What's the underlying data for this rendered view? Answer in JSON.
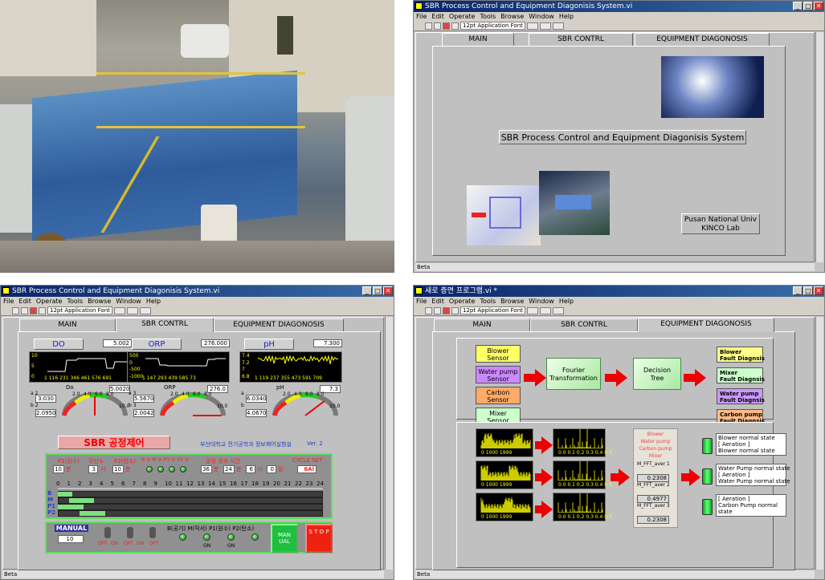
{
  "window_controls": {
    "min": "_",
    "max": "□",
    "close": "✕"
  },
  "menu": [
    "File",
    "Edit",
    "Operate",
    "Tools",
    "Browse",
    "Window",
    "Help"
  ],
  "toolbar": {
    "font": "12pt Application Font"
  },
  "status_bar": "Beta",
  "win1": {
    "title": "SBR Process Control and Equipment Diagonisis System.vi",
    "tabs": [
      "MAIN",
      "SBR CONTRL",
      "EQUIPMENT DIAGONOSIS"
    ],
    "banner": "SBR Process Control and Equipment Diagonisis System",
    "org_line1": "Pusan National Univ",
    "org_line2": "KINCO Lab"
  },
  "win2": {
    "title": "SBR Process Control and Equipment Diagonisis System.vi",
    "tabs": [
      "MAIN",
      "SBR CONTRL",
      "EQUIPMENT DIAGONOSIS"
    ],
    "do": {
      "label": "DO",
      "value": "5.002",
      "axis": [
        "10",
        "5",
        "0"
      ],
      "x": "1  116 231 346 461 576 691",
      "name": "Do",
      "meas": "5.0020",
      "a": "3.030",
      "b": "2.0950",
      "ga": "a 2",
      "gb": "b 2",
      "scale": [
        "2.0",
        "4.0",
        "6.0",
        "8.0"
      ],
      "end": "10.0"
    },
    "orp": {
      "label": "ORP",
      "value": "276.000",
      "axis": [
        "500",
        "0",
        "-500",
        "-1000"
      ],
      "x": "1  147 293 439 585 73",
      "name": "ORP",
      "meas": "276.0",
      "a": "5.5670",
      "b": "2.0042",
      "ga": "a 3",
      "gb": "b 3",
      "scale": [
        "2.0",
        "4.0",
        "6.0",
        "8.0"
      ],
      "end": "10.0"
    },
    "ph": {
      "label": "pH",
      "value": "7.300",
      "axis": [
        "7.4",
        "7.2",
        "7",
        "6.8"
      ],
      "x": "1  119 237 355 473 591 709",
      "name": "pH",
      "meas": "7.3",
      "a": "6.0340",
      "b": "4.0670",
      "ga": "a",
      "gb": "b",
      "scale": [
        "2.0",
        "4.0",
        "6.0",
        "8.0"
      ],
      "end": "10.0"
    },
    "process_title": "SBR 공정제어",
    "dept": "부산대학교 전기공학과 정보제어실험실",
    "ver": "Ver. 2",
    "cycle": {
      "p1_label": "P1(원수)",
      "p1": "10",
      "p1_unit": "분",
      "mix_label": "무산소",
      "mix": "3",
      "mix_unit": "시",
      "p2_label": "P2(탄소)",
      "p2": "10",
      "p2_unit": "분",
      "on_label": "B ② M ② P1 ② P2 ②",
      "time_label": "공정 경과 시간",
      "t1": "36",
      "t1u": "분",
      "t2": "24",
      "t2u": "분",
      "t3": "6",
      "t3u": "시",
      "t4": "0",
      "t4u": "일",
      "cycle_label": "CYCLE SET",
      "cycle": "6Al"
    },
    "hours": [
      "0",
      "1",
      "2",
      "3",
      "4",
      "5",
      "6",
      "7",
      "8",
      "9",
      "10",
      "11",
      "12",
      "13",
      "14",
      "15",
      "16",
      "17",
      "18",
      "19",
      "20",
      "21",
      "22",
      "23",
      "24"
    ],
    "rows": [
      "B",
      "M",
      "P1",
      "P2"
    ],
    "manual_label": "MANUAL",
    "manual_val": "10",
    "switch_labels": [
      "OFF",
      "ON",
      "OFF",
      "ON",
      "OFF"
    ],
    "lamp_label": "B(공기) M(믹서) P1(원수) P2(탄소)",
    "lamp_on": [
      "ON",
      "ON"
    ],
    "man_btn": "MAN UAL",
    "stop_btn": "S T O P"
  },
  "win3": {
    "title": "SBR Process Control and Equipment Diagonisis System.vi",
    "tabs": [
      "MAIN",
      "SBR CONTRL",
      "EQUIPMENT DIAGONOSIS"
    ]
  },
  "win4": {
    "title": "새로 증면 프로그램.vi *",
    "tabs": [
      "MAIN",
      "SBR CONTRL",
      "EQUIPMENT DIAGONOSIS"
    ],
    "sensors": [
      {
        "label": "Blower\nSensor",
        "color": "#ffff66"
      },
      {
        "label": "Water pump\nSensor",
        "color": "#cc88ff"
      },
      {
        "label": "Carbon\nSensor",
        "color": "#ffaa66"
      },
      {
        "label": "Mixer\nSensor",
        "color": "#ccffcc"
      }
    ],
    "fourier": "Fourier\nTransformation",
    "decision": "Decision\nTree",
    "faults": [
      {
        "label": "Blower\nFault Diagnsis",
        "color": "#ffff88"
      },
      {
        "label": "Mixer\nFault Diagnsis",
        "color": "#ccffcc"
      },
      {
        "label": "Water pump\nFault Diagnsis",
        "color": "#cc99ff"
      },
      {
        "label": "Carbon pump\nFault Diagnsis",
        "color": "#ffbb88"
      }
    ],
    "legend": [
      "Blower",
      "Water pump",
      "Carbon pump",
      "Mixer"
    ],
    "mfft": [
      {
        "label": "M_FFT_aver 1",
        "val": "0.2308"
      },
      {
        "label": "M_FFT_aver 2",
        "val": "0.4977"
      },
      {
        "label": "M_FFT_aver 3",
        "val": "0.2308"
      }
    ],
    "spec_x": "0    1000    1999",
    "fft_x": "0.0 0.1 0.2 0.3 0.4 0.5",
    "status": [
      "Blower normal state\n[ Aeration ]\nBlower normal state",
      "Water Pump normal state\n[ Aeration ]\nWater Pump normal state",
      "[ Aeration ]\nCarbon Pump normal\nstate"
    ]
  }
}
